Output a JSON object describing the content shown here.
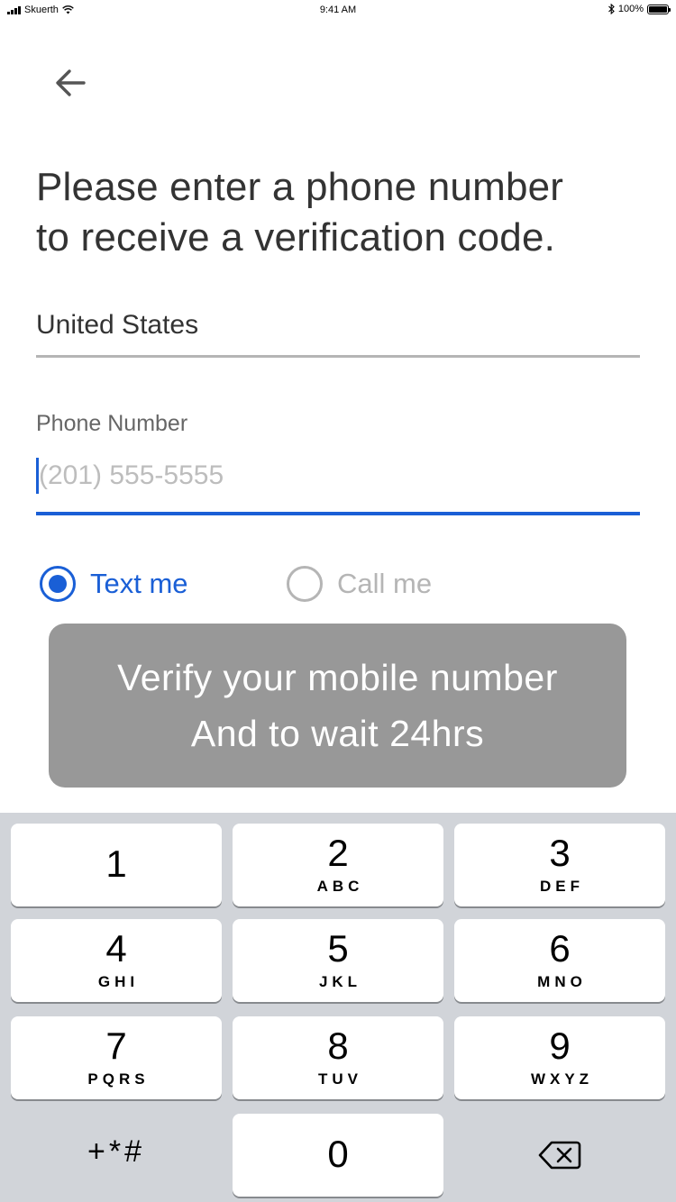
{
  "status_bar": {
    "carrier": "Skuerth",
    "time": "9:41 AM",
    "battery": "100%",
    "icons": [
      "signal-icon",
      "wifi-icon",
      "bluetooth-icon",
      "battery-icon"
    ]
  },
  "header": {
    "back_icon": "arrow-left-icon"
  },
  "title": {
    "line1": "Please enter a phone number",
    "line2": "to receive a verification code."
  },
  "country": {
    "value": "United States"
  },
  "phone": {
    "label": "Phone Number",
    "placeholder": "(201) 555-5555",
    "value": ""
  },
  "delivery": {
    "options": [
      {
        "label": "Text me",
        "selected": true
      },
      {
        "label": "Call me",
        "selected": false
      }
    ]
  },
  "toast": {
    "line1": "Verify your mobile number",
    "line2": "And to wait 24hrs"
  },
  "keypad": {
    "keys": [
      {
        "digit": "1",
        "letters": ""
      },
      {
        "digit": "2",
        "letters": "ABC"
      },
      {
        "digit": "3",
        "letters": "DEF"
      },
      {
        "digit": "4",
        "letters": "GHI"
      },
      {
        "digit": "5",
        "letters": "JKL"
      },
      {
        "digit": "6",
        "letters": "MNO"
      },
      {
        "digit": "7",
        "letters": "PQRS"
      },
      {
        "digit": "8",
        "letters": "TUV"
      },
      {
        "digit": "9",
        "letters": "WXYZ"
      },
      {
        "digit": "0",
        "letters": ""
      }
    ],
    "symbols": "+*#",
    "delete_icon": "backspace-icon"
  },
  "colors": {
    "accent": "#1a5fd6",
    "text": "#333333",
    "muted": "#b5b5b5",
    "toast_bg": "#989898",
    "keypad_bg": "#d1d4d9"
  }
}
